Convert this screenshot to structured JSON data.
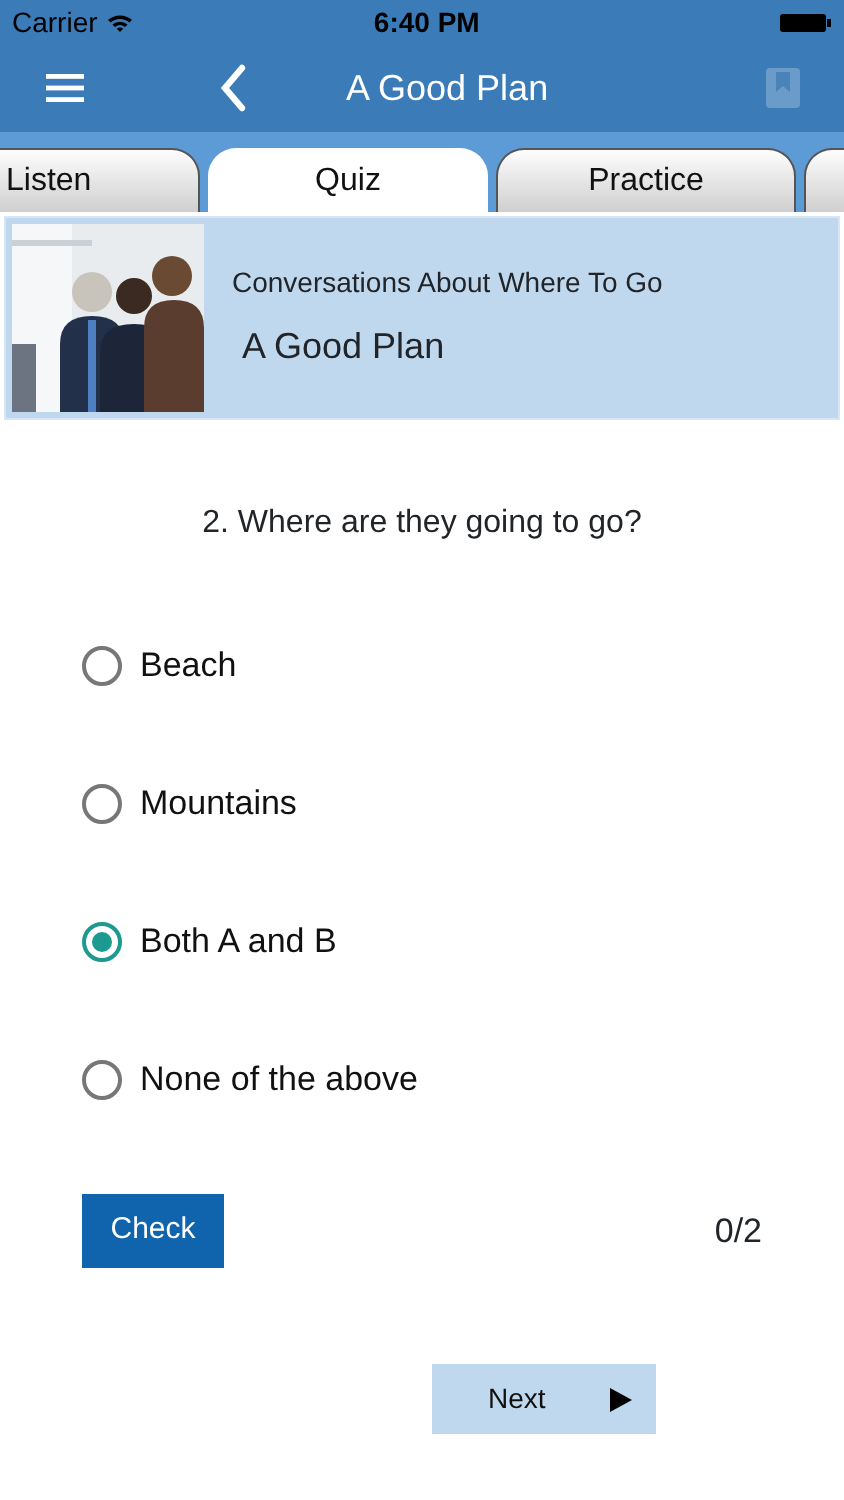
{
  "status_bar": {
    "carrier": "Carrier",
    "time": "6:40 PM"
  },
  "nav": {
    "title": "A Good Plan"
  },
  "tabs": [
    {
      "label": "Listen",
      "selected": false
    },
    {
      "label": "Quiz",
      "selected": true
    },
    {
      "label": "Practice",
      "selected": false
    }
  ],
  "lesson": {
    "category": "Conversations About Where To Go",
    "title": "A Good Plan"
  },
  "question": "2. Where are they going to go?",
  "options": [
    {
      "label": "Beach",
      "selected": false
    },
    {
      "label": "Mountains",
      "selected": false
    },
    {
      "label": "Both A and B",
      "selected": true
    },
    {
      "label": "None of the above",
      "selected": false
    }
  ],
  "check_button": "Check",
  "score": "0/2",
  "next_button": "Next"
}
